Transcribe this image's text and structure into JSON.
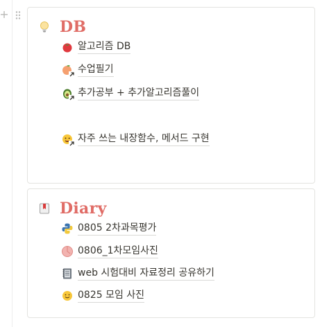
{
  "db_card": {
    "title": "DB",
    "items": [
      {
        "label": "알고리즘 DB"
      },
      {
        "label": "수업필기"
      },
      {
        "label": "추가공부 + 추가알고리즘풀이"
      },
      {
        "label": "자주 쓰는 내장함수, 메서드 구현"
      }
    ]
  },
  "diary_card": {
    "title": "Diary",
    "items": [
      {
        "label": "0805 2차과목평가"
      },
      {
        "label": "0806_1차모임사진"
      },
      {
        "label": "web 시험대비 자료정리 공유하기"
      },
      {
        "label": "0825 모임 사진"
      }
    ]
  },
  "colors": {
    "heading": "#e06c66",
    "border": "#e3e3e0",
    "text": "#37352f"
  },
  "icons": {
    "db": "lightbulb-icon",
    "diary": "bookmark-book-icon",
    "db_items": [
      "tomato-icon",
      "peach-link-icon",
      "avocado-link-icon",
      "winking-face-link-icon"
    ],
    "diary_items": [
      "python-logo-icon",
      "peach-ball-icon",
      "notebook-icon",
      "smiley-face-icon"
    ]
  }
}
